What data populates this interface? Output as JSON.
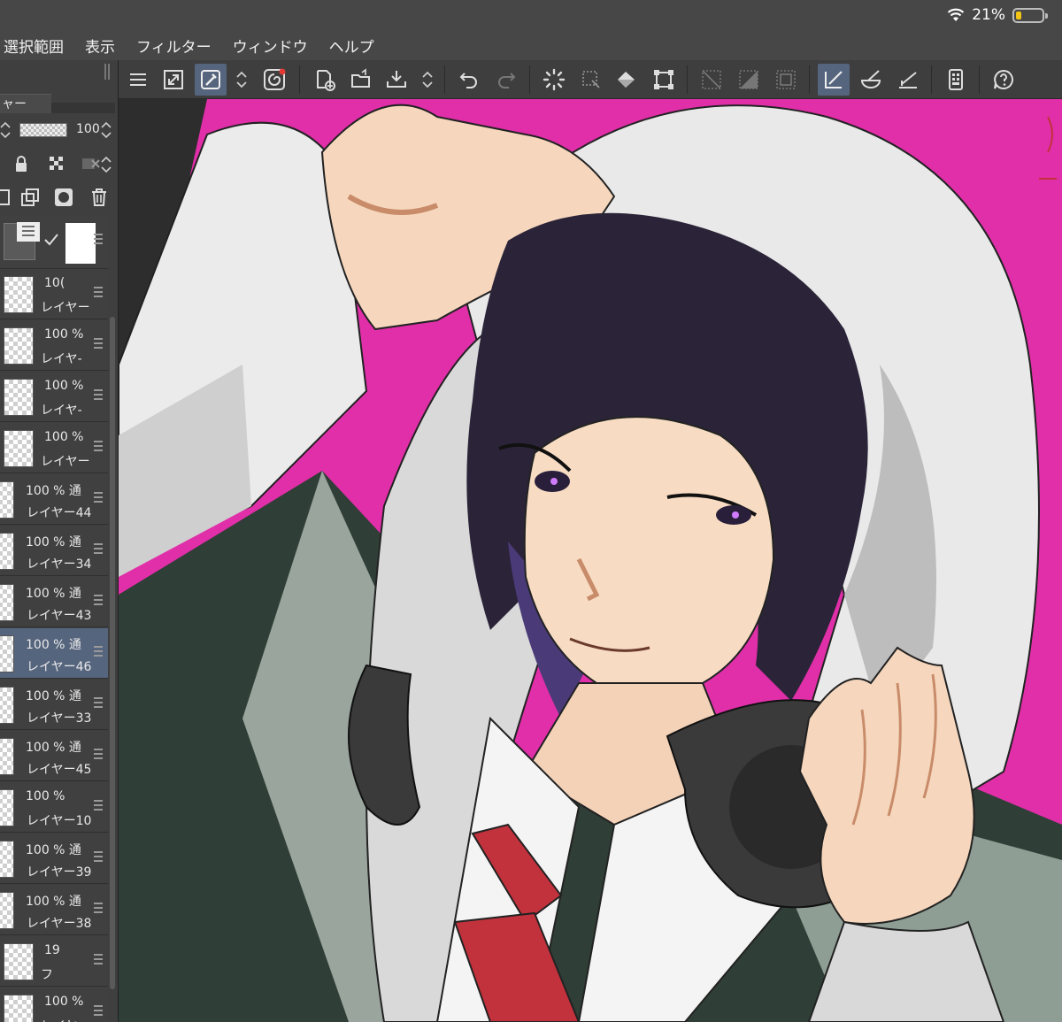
{
  "status": {
    "battery_text": "21%",
    "battery_level": 0.21,
    "wifi_icon": "wifi-icon"
  },
  "menu": [
    "選択範囲",
    "表示",
    "フィルター",
    "ウィンドウ",
    "ヘルプ"
  ],
  "toolbar": {
    "icons": [
      "menu-icon",
      "fit-to-screen-icon",
      "eyedropper-icon",
      "stepper-icon",
      "quick-access-icon",
      "new-document-icon",
      "open-folder-icon",
      "save-icon",
      "stepper-icon",
      "undo-icon",
      "redo-icon",
      "loading-spinner-icon",
      "selection-icon",
      "fill-icon",
      "transform-icon",
      "deselect-icon",
      "invert-selection-icon",
      "show-selection-icon",
      "line-tool-icon",
      "brush-icon",
      "ruler-icon",
      "device-settings-icon",
      "help-icon"
    ],
    "active": [
      "eyedropper-icon",
      "line-tool-icon"
    ]
  },
  "layer_panel": {
    "tab_label": "ャー",
    "opacity_value": "100",
    "opacity_level": 1.0,
    "layers": [
      {
        "opacity": "10(",
        "name": "レイヤー",
        "selected": false
      },
      {
        "opacity": "100 %",
        "name": "レイヤ-",
        "selected": false
      },
      {
        "opacity": "100 %",
        "name": "レイヤ-",
        "selected": false
      },
      {
        "opacity": "100 %",
        "name": "レイヤー",
        "selected": false
      },
      {
        "opacity": "100 % 通",
        "name": "レイヤー44",
        "selected": false
      },
      {
        "opacity": "100 % 通",
        "name": "レイヤー34",
        "selected": false
      },
      {
        "opacity": "100 % 通",
        "name": "レイヤー43",
        "selected": false
      },
      {
        "opacity": "100 % 通",
        "name": "レイヤー46",
        "selected": true
      },
      {
        "opacity": "100 % 通",
        "name": "レイヤー33",
        "selected": false
      },
      {
        "opacity": "100 % 通",
        "name": "レイヤー45",
        "selected": false
      },
      {
        "opacity": "100 %",
        "name": "レイヤー10",
        "selected": false
      },
      {
        "opacity": "100 % 通",
        "name": "レイヤー39",
        "selected": false
      },
      {
        "opacity": "100 % 通",
        "name": "レイヤー38",
        "selected": false
      },
      {
        "opacity": "19",
        "name": "フ",
        "selected": false
      },
      {
        "opacity": "100 %",
        "name": "レイヤー",
        "selected": false
      }
    ]
  },
  "colors": {
    "accent_selected": "#56657e",
    "canvas_magenta": "#e02fa8",
    "hair": "#2b2438",
    "hood": "#e9e9ea",
    "jacket": "#2f3e36",
    "tie": "#c2323c"
  }
}
